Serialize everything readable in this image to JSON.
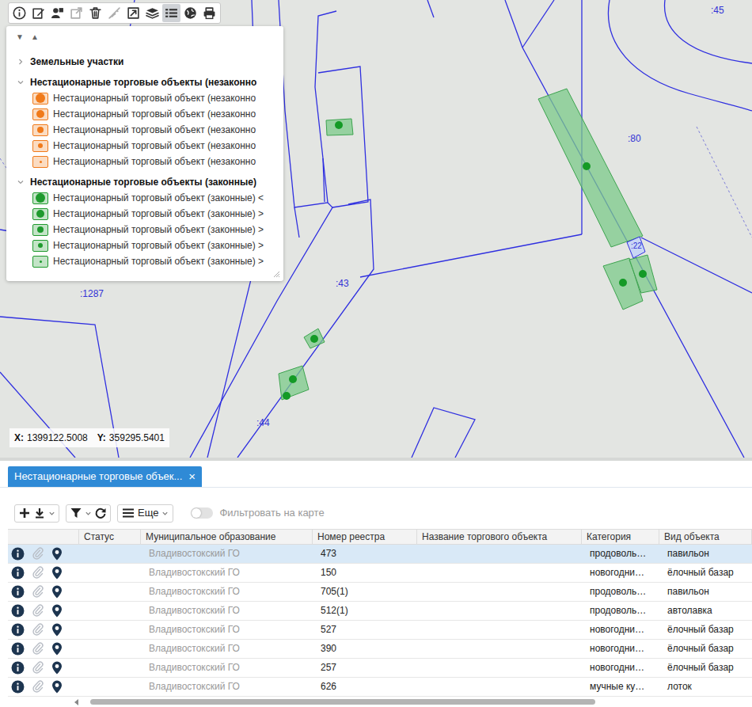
{
  "map": {
    "toolbar": [
      {
        "kind": "info",
        "selected": false,
        "disabled": false
      },
      {
        "kind": "edit",
        "selected": false,
        "disabled": false
      },
      {
        "kind": "shapes",
        "selected": false,
        "disabled": false
      },
      {
        "kind": "open",
        "selected": false,
        "disabled": true
      },
      {
        "kind": "delete",
        "selected": false,
        "disabled": false
      },
      {
        "kind": "measure",
        "selected": false,
        "disabled": true
      },
      {
        "kind": "edit-box",
        "selected": false,
        "disabled": false
      },
      {
        "kind": "layers",
        "selected": false,
        "disabled": false
      },
      {
        "kind": "list",
        "selected": true,
        "disabled": false
      },
      {
        "kind": "globe",
        "selected": false,
        "disabled": false
      },
      {
        "kind": "print",
        "selected": false,
        "disabled": false
      }
    ],
    "legend": {
      "collapse_all": "▼",
      "expand_all": "▲",
      "groups": [
        {
          "title": "Земельные участки",
          "expanded": false,
          "items": []
        },
        {
          "title": "Нестационарные торговые объекты (незаконно",
          "expanded": true,
          "items": [
            {
              "label": "Нестационарный торговый объект (незаконно",
              "color": "#f07a1a"
            },
            {
              "label": "Нестационарный торговый объект (незаконно",
              "color": "#f07a1a"
            },
            {
              "label": "Нестационарный торговый объект (незаконно",
              "color": "#f07a1a"
            },
            {
              "label": "Нестационарный торговый объект (незаконно",
              "color": "#f07a1a"
            },
            {
              "label": "Нестационарный торговый объект (незаконно",
              "color": "#f07a1a"
            }
          ]
        },
        {
          "title": "Нестационарные торговые объекты (законные)",
          "expanded": true,
          "items": [
            {
              "label": "Нестационарный торговый объект (законные) <",
              "color": "#1f9a2e"
            },
            {
              "label": "Нестационарный торговый объект (законные) >",
              "color": "#1f9a2e"
            },
            {
              "label": "Нестационарный торговый объект (законные) >",
              "color": "#1f9a2e"
            },
            {
              "label": "Нестационарный торговый объект (законные) >",
              "color": "#1f9a2e"
            },
            {
              "label": "Нестационарный торговый объект (законные) >",
              "color": "#1f9a2e"
            }
          ]
        }
      ]
    },
    "parcel_labels": [
      ":45",
      ":80",
      ":1287",
      ":43",
      ":44",
      ":22"
    ],
    "coordinates": {
      "x_label": "X:",
      "x": "1399122.5008",
      "y_label": "Y:",
      "y": "359295.5401"
    }
  },
  "panel": {
    "tabs": [
      {
        "label": "Нестационарные торговые объек...",
        "selected": true,
        "close": "×"
      }
    ],
    "toolbar": {
      "more": "Еще",
      "filter_on_map": {
        "label": "Фильтровать на карте",
        "on": false
      }
    },
    "table": {
      "columns": [
        "Статус",
        "Муниципальное образование",
        "Номер реестра",
        "Название торгового объекта",
        "Категория",
        "Вид объекта"
      ],
      "rows": [
        {
          "selected": true,
          "cells": [
            "",
            "Владивостокский ГО",
            "473",
            "",
            "продоволь…",
            "павильон"
          ]
        },
        {
          "selected": false,
          "cells": [
            "",
            "Владивостокский ГО",
            "150",
            "",
            "новогодни…",
            "ёлочный базар"
          ]
        },
        {
          "selected": false,
          "cells": [
            "",
            "Владивостокский ГО",
            "705(1)",
            "",
            "продоволь…",
            "павильон"
          ]
        },
        {
          "selected": false,
          "cells": [
            "",
            "Владивостокский ГО",
            "512(1)",
            "",
            "продоволь…",
            "автолавка"
          ]
        },
        {
          "selected": false,
          "cells": [
            "",
            "Владивостокский ГО",
            "527",
            "",
            "новогодни…",
            "ёлочный базар"
          ]
        },
        {
          "selected": false,
          "cells": [
            "",
            "Владивостокский ГО",
            "390",
            "",
            "новогодни…",
            "ёлочный базар"
          ]
        },
        {
          "selected": false,
          "cells": [
            "",
            "Владивостокский ГО",
            "257",
            "",
            "новогодни…",
            "ёлочный базар"
          ]
        },
        {
          "selected": false,
          "cells": [
            "",
            "Владивостокский ГО",
            "626",
            "",
            "мучные ку…",
            "лоток"
          ]
        }
      ]
    }
  }
}
